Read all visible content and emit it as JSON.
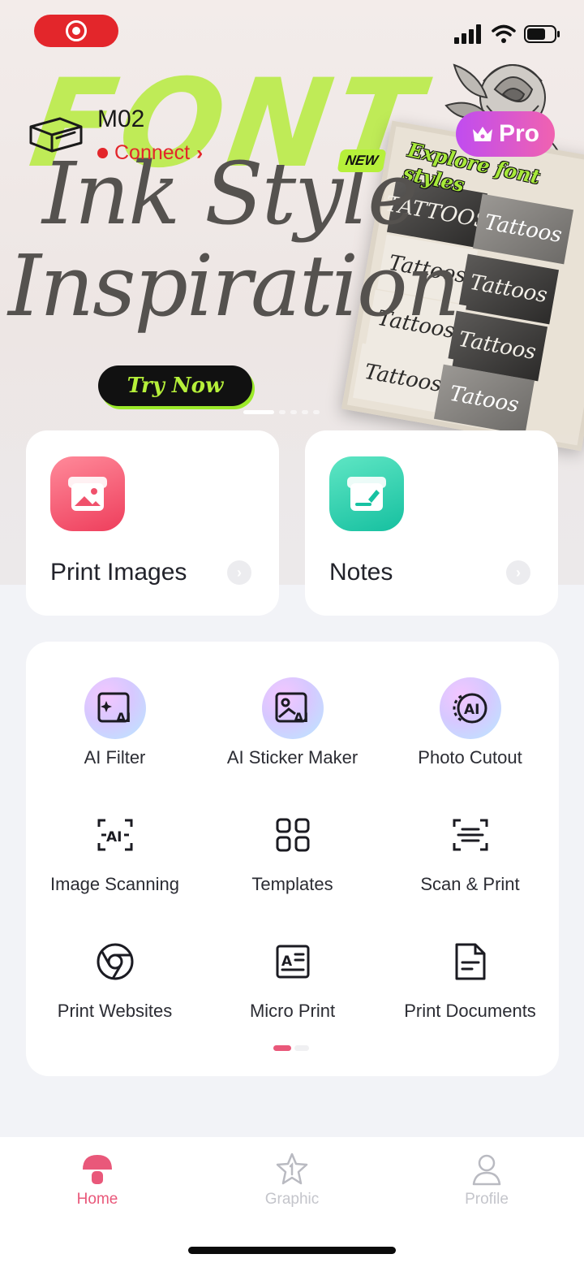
{
  "status_bar": {
    "recording_icon": "record-icon",
    "icons": [
      "signal-icon",
      "wifi-icon",
      "battery-icon"
    ]
  },
  "device": {
    "name": "M02",
    "status": "Connect",
    "icon": "printer-icon"
  },
  "pro": {
    "label": "Pro",
    "icon": "crown-icon"
  },
  "banner": {
    "big_word": "FONT",
    "headline_line1": "Ink Style",
    "headline_line2": "Inspiration",
    "badge": "NEW",
    "subtitle": "Explore font styles",
    "cta": "Try Now",
    "samples": [
      "TATTOOS",
      "Tattoos",
      "Tattoos",
      "Tattoos",
      "Tattoos",
      "Tattoos",
      "Tattoos",
      "Tatoos"
    ],
    "slide_count": 6,
    "active_slide": 1
  },
  "quick_actions": [
    {
      "label": "Print Images",
      "icon": "image-print-icon",
      "color": "#ee3e5c"
    },
    {
      "label": "Notes",
      "icon": "notes-icon",
      "color": "#16c0a0"
    }
  ],
  "tools": [
    {
      "label": "AI Filter",
      "icon": "ai-filter-icon"
    },
    {
      "label": "AI Sticker Maker",
      "icon": "ai-sticker-icon"
    },
    {
      "label": "Photo Cutout",
      "icon": "photo-cutout-icon"
    },
    {
      "label": "Image Scanning",
      "icon": "image-scan-icon"
    },
    {
      "label": "Templates",
      "icon": "templates-icon"
    },
    {
      "label": "Scan & Print",
      "icon": "scan-print-icon"
    },
    {
      "label": "Print Websites",
      "icon": "chrome-icon"
    },
    {
      "label": "Micro Print",
      "icon": "micro-print-icon"
    },
    {
      "label": "Print Documents",
      "icon": "document-icon"
    }
  ],
  "tools_pages": {
    "count": 2,
    "active": 1
  },
  "tabbar": [
    {
      "label": "Home",
      "icon": "mushroom-home-icon",
      "active": true
    },
    {
      "label": "Graphic",
      "icon": "star-graphic-icon",
      "active": false
    },
    {
      "label": "Profile",
      "icon": "profile-icon",
      "active": false
    }
  ],
  "colors": {
    "accent": "#e9587a",
    "connect_red": "#e3262b",
    "lime": "#b6f03a"
  }
}
